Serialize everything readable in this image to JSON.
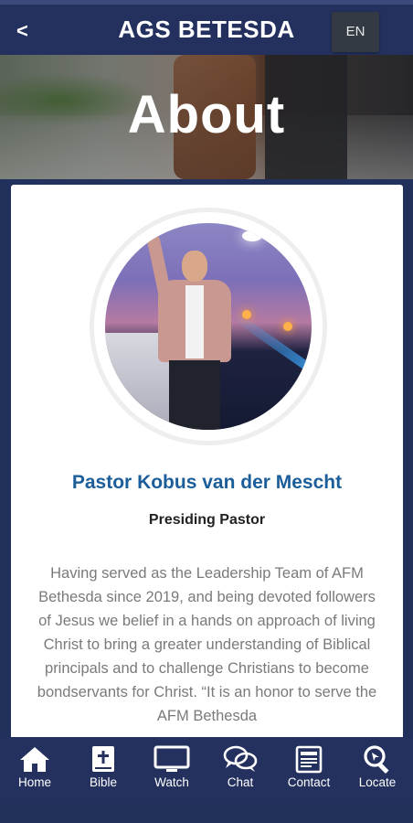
{
  "header": {
    "back_label": "<",
    "title": "AGS BETESDA",
    "language": "EN"
  },
  "hero": {
    "title": "About"
  },
  "profile": {
    "name": "Pastor Kobus van der Mescht",
    "role": "Presiding Pastor",
    "bio": "Having served as the Leadership Team of AFM Bethesda since 2019, and being devoted followers of Jesus we belief in a hands on approach of living Christ to bring a greater understanding of Biblical principals and to challenge Christians to become bondservants for Christ. “It is an honor to serve the AFM Bethesda"
  },
  "nav": {
    "items": [
      {
        "label": "Home",
        "icon": "home-icon"
      },
      {
        "label": "Bible",
        "icon": "bible-icon"
      },
      {
        "label": "Watch",
        "icon": "tv-icon"
      },
      {
        "label": "Chat",
        "icon": "chat-icon"
      },
      {
        "label": "Contact",
        "icon": "contact-icon"
      },
      {
        "label": "Locate",
        "icon": "locate-icon"
      }
    ]
  },
  "colors": {
    "primary": "#24315f",
    "name_blue": "#1b5e9a",
    "bio_gray": "#7a7a7a"
  }
}
